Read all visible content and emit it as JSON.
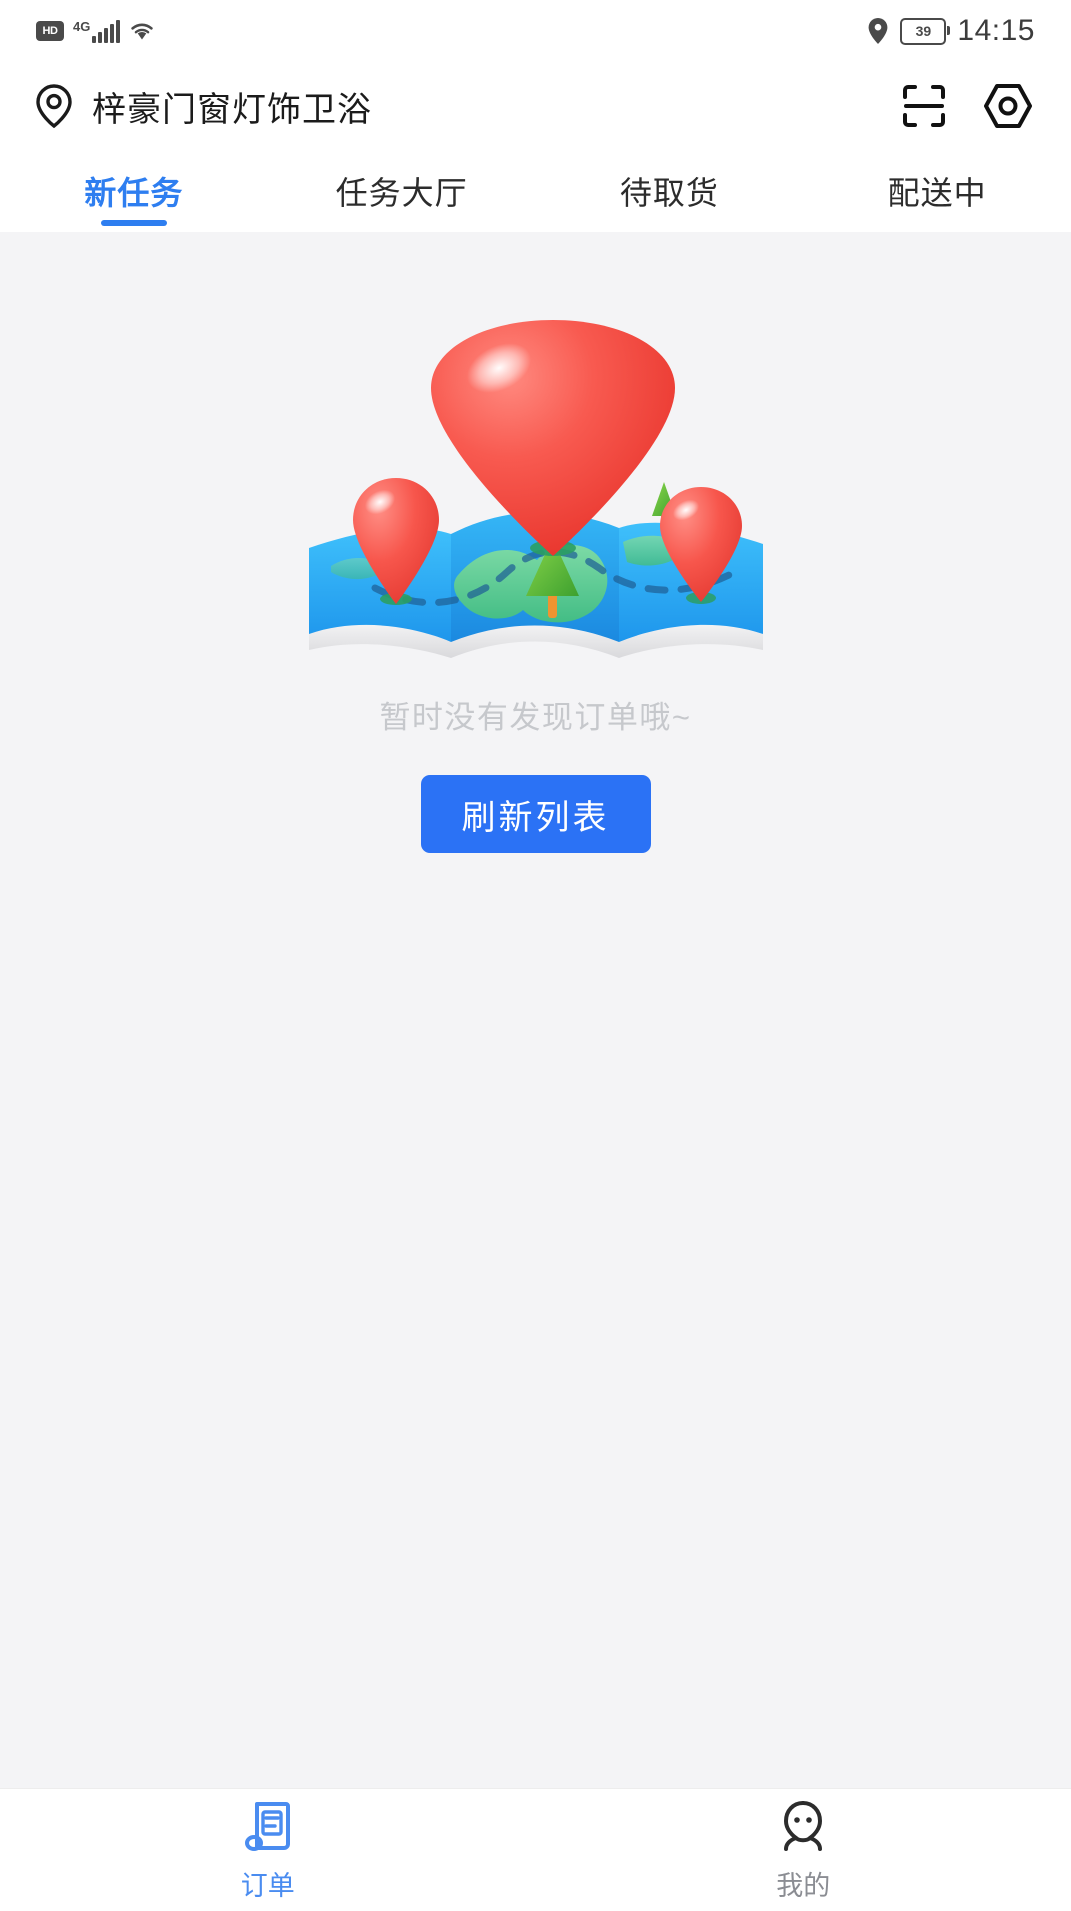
{
  "status_bar": {
    "hd_badge": "HD",
    "network_label": "4G",
    "signal_icon": "signal-bars-icon",
    "wifi_icon": "wifi-icon",
    "location_icon": "location-pin-icon",
    "battery_level": "39",
    "time": "14:15"
  },
  "header": {
    "location_icon": "location-pin-icon",
    "store_name": "梓豪门窗灯饰卫浴",
    "scan_icon": "scan-qr-icon",
    "eye_icon": "eye-view-icon"
  },
  "tabs": [
    {
      "label": "新任务",
      "active": true
    },
    {
      "label": "任务大厅",
      "active": false
    },
    {
      "label": "待取货",
      "active": false
    },
    {
      "label": "配送中",
      "active": false
    }
  ],
  "empty_state": {
    "illustration": "map-with-pins-illustration",
    "message": "暂时没有发现订单哦~",
    "refresh_button": "刷新列表"
  },
  "bottom_nav": [
    {
      "label": "订单",
      "icon": "order-receipt-icon",
      "active": true
    },
    {
      "label": "我的",
      "icon": "person-profile-icon",
      "active": false
    }
  ],
  "colors": {
    "accent_blue": "#2b72f5",
    "tab_active_blue": "#2e7ef0",
    "nav_active_blue": "#4a8cf0",
    "empty_text_gray": "#c6c8cc",
    "page_background": "#f4f4f6",
    "pin_red": "#f4453c",
    "map_water_blue": "#29a9f2",
    "map_land_green": "#5ec48b"
  }
}
